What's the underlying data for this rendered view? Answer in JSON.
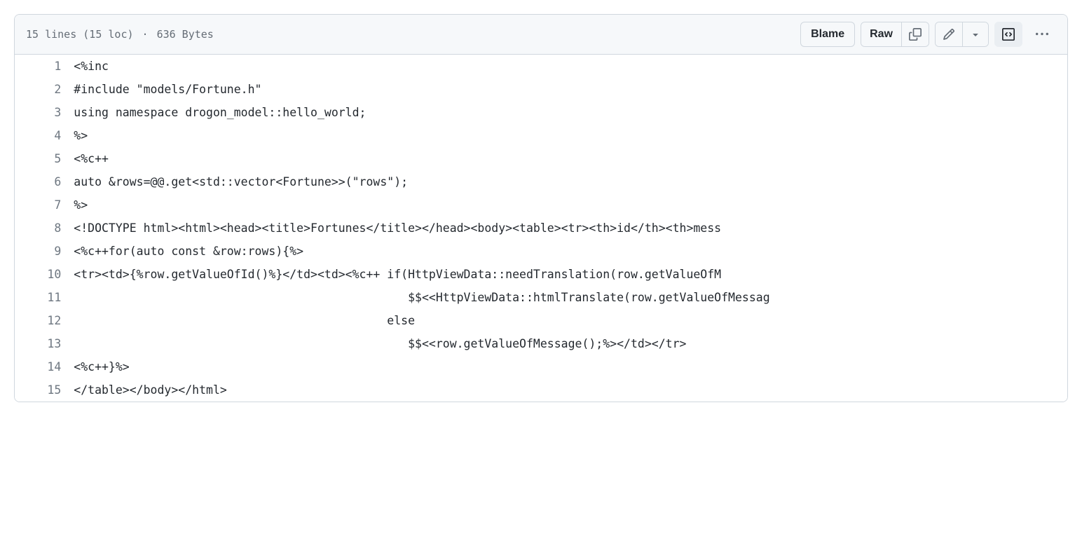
{
  "header": {
    "lines_text": "15 lines (15 loc)",
    "separator": "·",
    "size_text": "636 Bytes",
    "blame_label": "Blame",
    "raw_label": "Raw"
  },
  "code": {
    "lines": [
      "<%inc",
      "#include \"models/Fortune.h\"",
      "using namespace drogon_model::hello_world;",
      "%>",
      "<%c++",
      "auto &rows=@@.get<std::vector<Fortune>>(\"rows\");",
      "%>",
      "<!DOCTYPE html><html><head><title>Fortunes</title></head><body><table><tr><th>id</th><th>mess",
      "<%c++for(auto const &row:rows){%>",
      "<tr><td>{%row.getValueOfId()%}</td><td><%c++ if(HttpViewData::needTranslation(row.getValueOfM",
      "                                                $$<<HttpViewData::htmlTranslate(row.getValueOfMessag",
      "                                             else",
      "                                                $$<<row.getValueOfMessage();%></td></tr>",
      "<%c++}%>",
      "</table></body></html>"
    ]
  }
}
